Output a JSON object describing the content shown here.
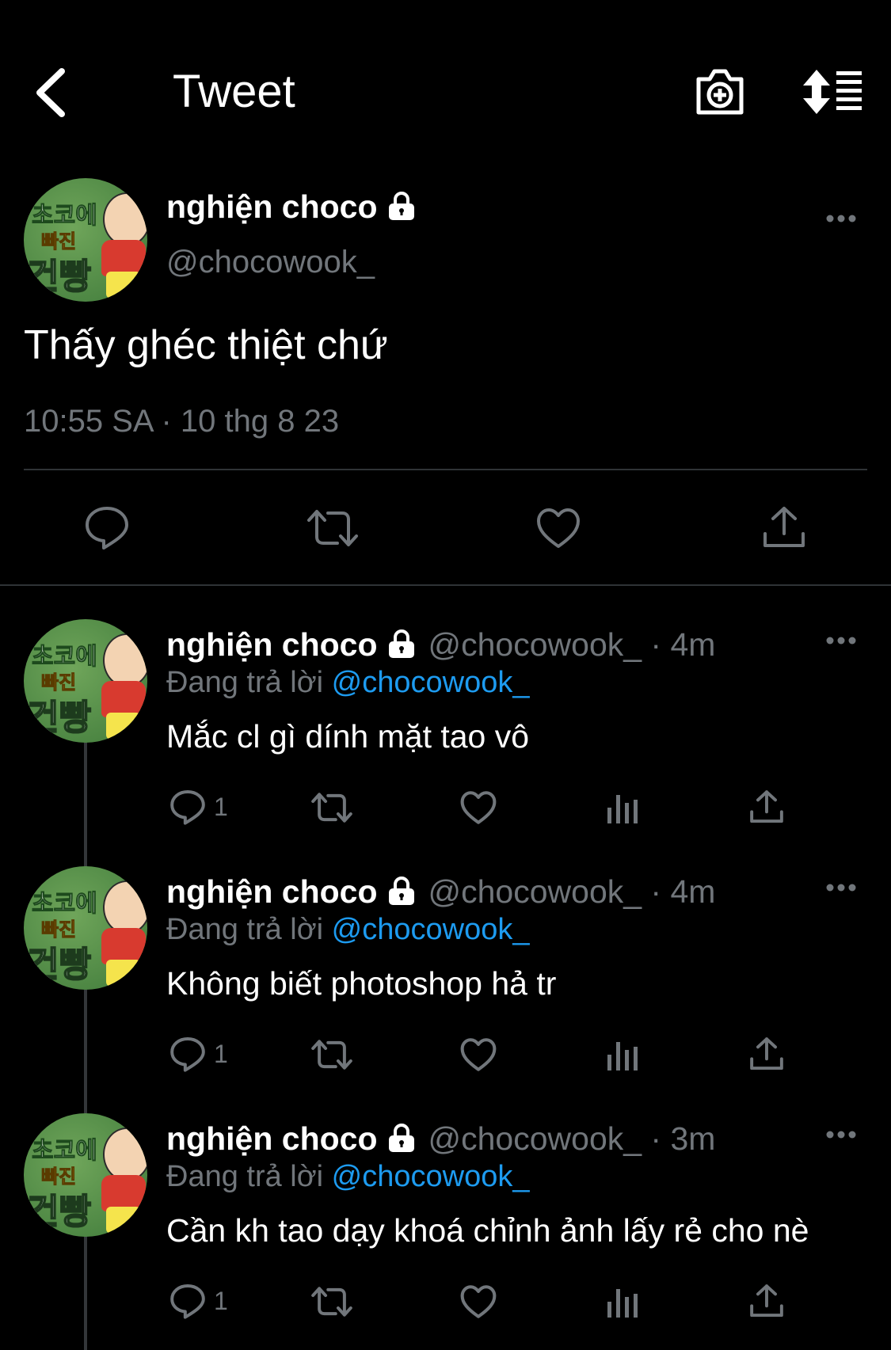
{
  "header": {
    "title": "Tweet",
    "back_icon": "chevron-left-icon",
    "camera_icon": "camera-plus-icon",
    "sort_icon": "sort-list-icon"
  },
  "avatar": {
    "line1": "초코에",
    "line2": "빠진",
    "line3": "건빵"
  },
  "main_tweet": {
    "name": "nghiện choco",
    "handle": "@chocowook_",
    "text": "Thấy ghéc thiệt chứ",
    "timestamp": "10:55 SA · 10 thg 8 23",
    "actions": [
      "reply-icon",
      "retweet-icon",
      "like-icon",
      "share-icon"
    ]
  },
  "replies": [
    {
      "name": "nghiện choco",
      "handle_time": "@chocowook_ · 4m",
      "reply_prefix": "Đang trả lời ",
      "reply_to": "@chocowook_",
      "text": "Mắc cl gì dính mặt tao vô",
      "reply_count": "1"
    },
    {
      "name": "nghiện choco",
      "handle_time": "@chocowook_ · 4m",
      "reply_prefix": "Đang trả lời ",
      "reply_to": "@chocowook_",
      "text": "Không biết photoshop hả tr",
      "reply_count": "1"
    },
    {
      "name": "nghiện choco",
      "handle_time": "@chocowook_ · 3m",
      "reply_prefix": "Đang trả lời ",
      "reply_to": "@chocowook_",
      "text": "Cần kh tao dạy khoá chỉnh ảnh lấy rẻ cho nè",
      "reply_count": "1"
    }
  ],
  "colors": {
    "background": "#000000",
    "text": "#ffffff",
    "secondary": "#71767b",
    "link": "#1d9bf0",
    "divider": "#2f3336"
  }
}
